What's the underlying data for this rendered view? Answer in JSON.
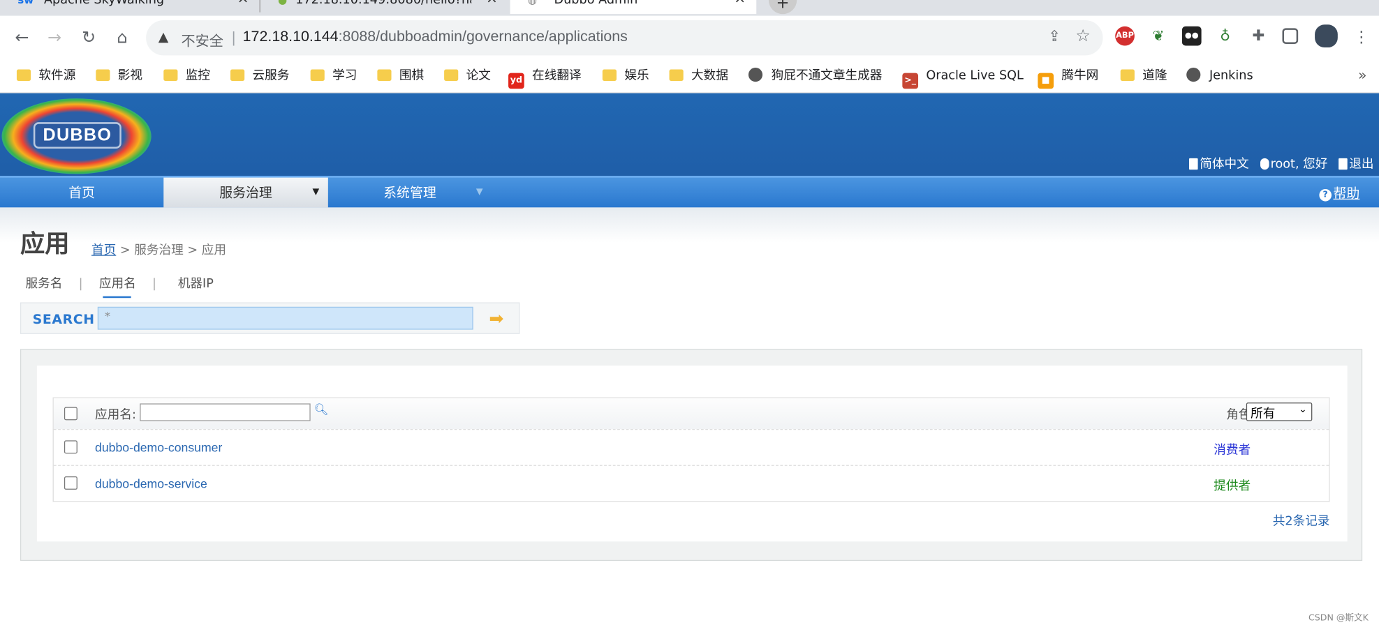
{
  "browser": {
    "tabs": [
      {
        "title": "Apache SkyWalking",
        "icon": "sw"
      },
      {
        "title": "172.18.10.149:8080/hello?nam",
        "icon": "leaf"
      },
      {
        "title": "Dubbo Admin",
        "icon": "globe"
      }
    ],
    "new_tab": "+",
    "address": {
      "security": "不安全",
      "separator": "|",
      "host": "172.18.10.144",
      "path": ":8088/dubboadmin/governance/applications"
    },
    "extensions": [
      "ABP",
      "leaf-ext",
      "tampermonkey",
      "adguard",
      "puzzle-icon",
      "sidebar-icon",
      "profile-avatar"
    ],
    "bookmarks": [
      {
        "label": "软件源",
        "icon": "folder"
      },
      {
        "label": "影视",
        "icon": "folder"
      },
      {
        "label": "监控",
        "icon": "folder"
      },
      {
        "label": "云服务",
        "icon": "folder"
      },
      {
        "label": "学习",
        "icon": "folder"
      },
      {
        "label": "围棋",
        "icon": "folder"
      },
      {
        "label": "论文",
        "icon": "folder"
      },
      {
        "label": "在线翻译",
        "icon": "yd"
      },
      {
        "label": "娱乐",
        "icon": "folder"
      },
      {
        "label": "大数据",
        "icon": "folder"
      },
      {
        "label": "狗屁不通文章生成器",
        "icon": "globe"
      },
      {
        "label": "Oracle Live SQL",
        "icon": "oracle"
      },
      {
        "label": "腾牛网",
        "icon": "tengniu"
      },
      {
        "label": "道隆",
        "icon": "folder"
      },
      {
        "label": "Jenkins",
        "icon": "globe"
      }
    ],
    "bookmarks_more": "»"
  },
  "header": {
    "logo_text": "DUBBO",
    "lang": "简体中文",
    "user": "root, 您好",
    "logout": "退出"
  },
  "nav": {
    "items": [
      "首页",
      "服务治理",
      "系统管理"
    ],
    "help": "帮助",
    "help_icon": "?"
  },
  "page": {
    "title": "应用",
    "breadcrumb": {
      "home": "首页",
      "sep": ">",
      "mid": "服务治理",
      "current": "应用"
    },
    "search_tabs": [
      "服务名",
      "应用名",
      "机器IP"
    ],
    "search_tab_sep": "|",
    "search": {
      "label": "SEARCH",
      "value": "*"
    }
  },
  "table": {
    "filter_label": "应用名:",
    "role_label": "角色:",
    "role_selected": "所有",
    "rows": [
      {
        "name": "dubbo-demo-consumer",
        "role": "消费者",
        "role_color": "#2b36d6"
      },
      {
        "name": "dubbo-demo-service",
        "role": "提供者",
        "role_color": "#1e8a1e"
      }
    ],
    "total": "共2条记录"
  },
  "watermark": "CSDN @斯文K"
}
